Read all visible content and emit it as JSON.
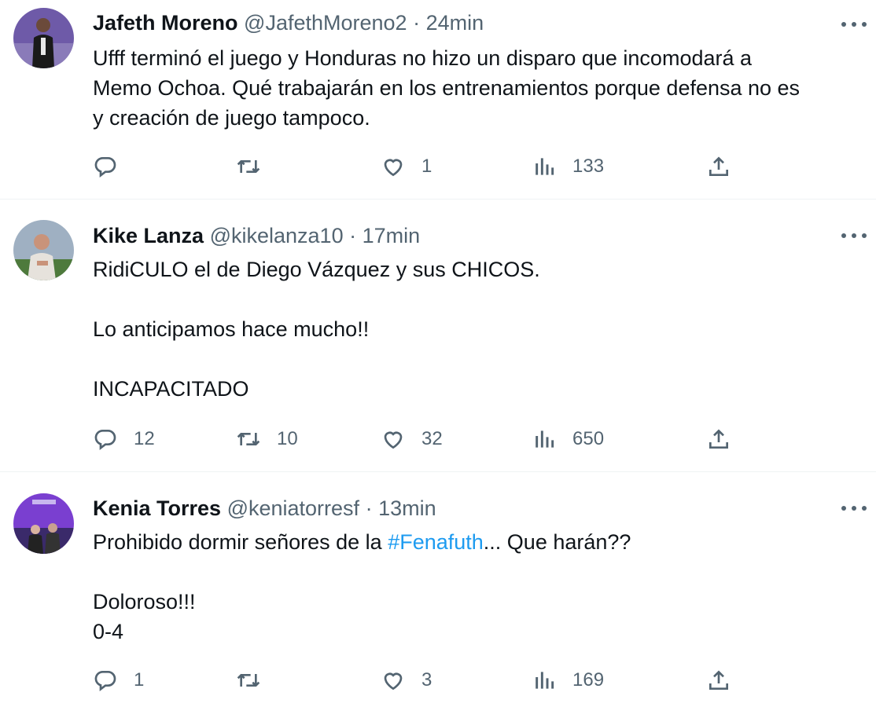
{
  "tweets": [
    {
      "name": "Jafeth Moreno",
      "handle": "@JafethMoreno2",
      "separator": "·",
      "time": "24min",
      "lines": [
        "Ufff terminó el juego y Honduras no hizo un disparo que incomodará a",
        "Memo Ochoa. Qué trabajarán en los entrenamientos porque defensa no es",
        "y creación de juego tampoco."
      ],
      "replies": "",
      "retweets": "",
      "likes": "1",
      "views": "133"
    },
    {
      "name": "Kike Lanza",
      "handle": "@kikelanza10",
      "separator": "·",
      "time": "17min",
      "para1": "RidiCULO el de Diego Vázquez y sus CHICOS.",
      "para2": "Lo anticipamos hace mucho!!",
      "para3": "INCAPACITADO",
      "replies": "12",
      "retweets": "10",
      "likes": "32",
      "views": "650"
    },
    {
      "name": "Kenia Torres",
      "handle": "@keniatorresf",
      "separator": "·",
      "time": "13min",
      "text_before": "Prohibido dormir señores de la ",
      "hashtag": "#Fenafuth",
      "text_after": "... Que harán??",
      "line2": "Doloroso!!!",
      "line3": "0-4",
      "replies": "1",
      "retweets": "",
      "likes": "3",
      "views": "169"
    }
  ],
  "colors": {
    "text": "#0f1419",
    "secondary": "#536471",
    "link": "#1d9bf0",
    "divider": "#eff3f4"
  },
  "icons": [
    "reply-icon",
    "retweet-icon",
    "like-icon",
    "views-icon",
    "share-icon",
    "more-icon"
  ]
}
